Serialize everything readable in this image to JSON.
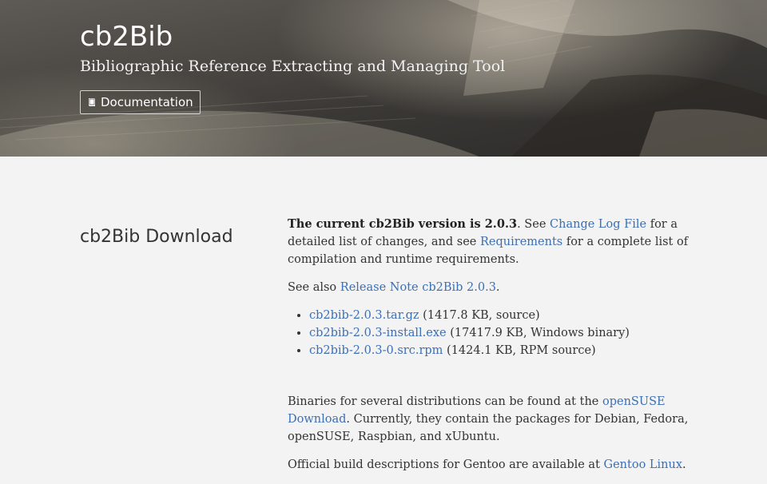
{
  "header": {
    "title": "cb2Bib",
    "subtitle": "Bibliographic Reference Extracting and Managing Tool",
    "doc_button": "Documentation"
  },
  "download": {
    "heading": "cb2Bib Download",
    "intro_bold": "The current cb2Bib version is 2.0.3",
    "intro_see": ". See ",
    "changelog_link": "Change Log File",
    "intro_mid": " for a detailed list of changes, and see ",
    "requirements_link": "Requirements",
    "intro_end": " for a complete list of compilation and runtime requirements.",
    "see_also": "See also ",
    "release_link": "Release Note cb2Bib 2.0.3",
    "period": ".",
    "files": [
      {
        "name": "cb2bib-2.0.3.tar.gz",
        "desc": " (1417.8 KB, source)"
      },
      {
        "name": "cb2bib-2.0.3-install.exe",
        "desc": " (17417.9 KB, Windows binary)"
      },
      {
        "name": "cb2bib-2.0.3-0.src.rpm",
        "desc": " (1424.1 KB, RPM source)"
      }
    ],
    "binaries_text": "Binaries for several distributions can be found at the ",
    "opensuse_link": "openSUSE Download",
    "binaries_end": ". Currently, they contain the packages for Debian, Fedora, openSUSE, Raspbian, and xUbuntu.",
    "gentoo_text": "Official build descriptions for Gentoo are available at ",
    "gentoo_link": "Gentoo Linux",
    "gentoo_end": "."
  },
  "colors": {
    "link": "#3b6fb6",
    "page_bg": "#f3f3f3",
    "text": "#333333"
  },
  "icons": {
    "doc_button_icon": "book-icon"
  }
}
